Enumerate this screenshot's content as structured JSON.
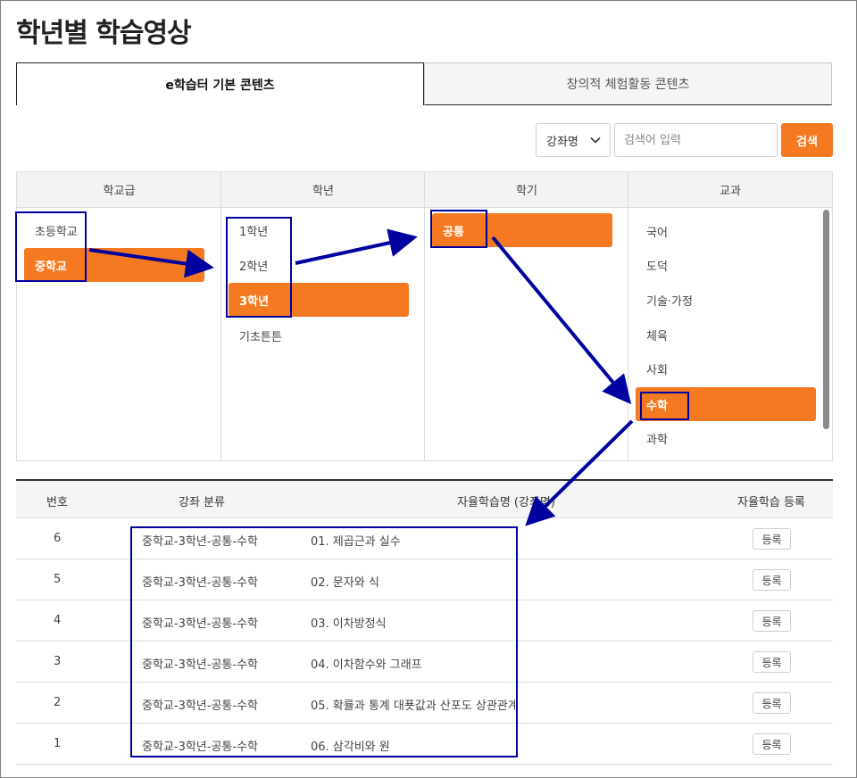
{
  "page_title": "학년별 학습영상",
  "tabs": [
    {
      "label": "e학습터 기본 콘텐츠",
      "active": true
    },
    {
      "label": "창의적 체험활동 콘텐츠",
      "active": false
    }
  ],
  "search": {
    "select_value": "강좌명",
    "placeholder": "검색어 입력",
    "button_label": "검색"
  },
  "filters": {
    "columns": [
      {
        "header": "학교급",
        "options": [
          "초등학교",
          "중학교"
        ],
        "selected": "중학교"
      },
      {
        "header": "학년",
        "options": [
          "1학년",
          "2학년",
          "3학년",
          "기초튼튼"
        ],
        "selected": "3학년"
      },
      {
        "header": "학기",
        "options": [
          "공통"
        ],
        "selected": "공통"
      },
      {
        "header": "교과",
        "options": [
          "국어",
          "도덕",
          "기술·가정",
          "체육",
          "사회",
          "수학",
          "과학"
        ],
        "selected": "수학"
      }
    ]
  },
  "table": {
    "headers": [
      "번호",
      "강좌 분류",
      "자율학습명 (강좌명)",
      "자율학습 등록"
    ],
    "register_label": "등록",
    "rows": [
      {
        "no": "6",
        "category": "중학교-3학년-공통-수학",
        "title": "01. 제곱근과 실수"
      },
      {
        "no": "5",
        "category": "중학교-3학년-공통-수학",
        "title": "02. 문자와 식"
      },
      {
        "no": "4",
        "category": "중학교-3학년-공통-수학",
        "title": "03. 이차방정식"
      },
      {
        "no": "3",
        "category": "중학교-3학년-공통-수학",
        "title": "04. 이차함수와 그래프"
      },
      {
        "no": "2",
        "category": "중학교-3학년-공통-수학",
        "title": "05. 확률과 통계 대푯값과 산포도 상관관계"
      },
      {
        "no": "1",
        "category": "중학교-3학년-공통-수학",
        "title": "06. 삼각비와 원"
      }
    ]
  },
  "colors": {
    "accent": "#f47920",
    "annotation": "#00009e"
  }
}
